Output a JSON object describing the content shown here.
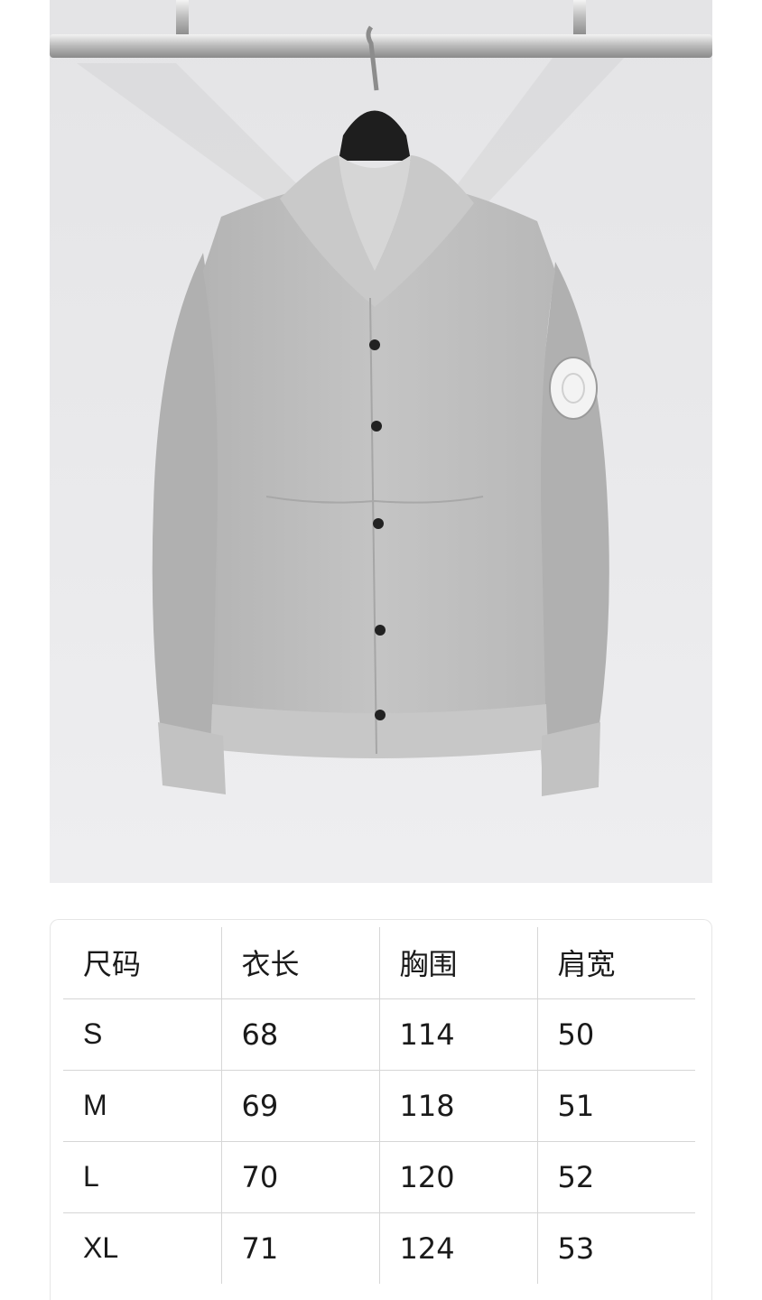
{
  "product_photo": {
    "alt": ""
  },
  "size_table": {
    "headers": [
      "尺码",
      "衣长",
      "胸围",
      "肩宽"
    ],
    "rows": [
      [
        "S",
        "68",
        "114",
        "50"
      ],
      [
        "M",
        "69",
        "118",
        "51"
      ],
      [
        "L",
        "70",
        "120",
        "52"
      ],
      [
        "XL",
        "71",
        "124",
        "53"
      ]
    ]
  },
  "colors": {
    "jacket": "#bcbcbc",
    "wall": "#e9e9eb",
    "hanger": "#1e1e1e"
  }
}
